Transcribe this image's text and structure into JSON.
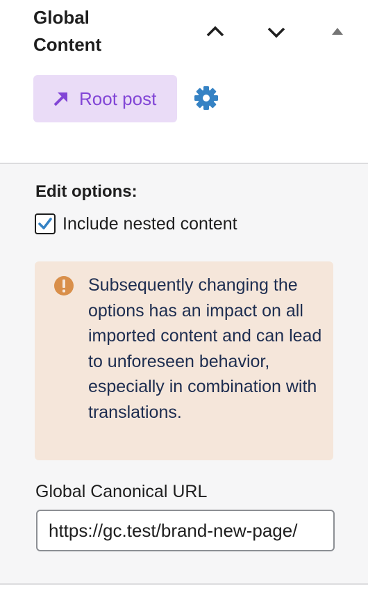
{
  "panel": {
    "title": "Global Content",
    "move_up_icon": "chevron-up-icon",
    "move_down_icon": "chevron-down-icon",
    "toggle_icon": "triangle-up-icon"
  },
  "root_post_button": {
    "label": "Root post",
    "icon": "arrow-up-right-icon",
    "background": "#eadcf7",
    "color": "#8246d6"
  },
  "settings": {
    "icon": "gear-icon",
    "color": "#3582c4"
  },
  "edit_options": {
    "heading": "Edit options:",
    "include_nested": {
      "label": "Include nested content",
      "checked": true
    }
  },
  "notice": {
    "icon": "warning-icon",
    "text": "Subsequently changing the options has an impact on all imported content and can lead to unforeseen behavior, especially in combination with translations.",
    "background": "#f5e6da",
    "icon_color": "#d98f4a"
  },
  "canonical": {
    "label": "Global Canonical URL",
    "value": "https://gc.test/brand-new-page/"
  }
}
